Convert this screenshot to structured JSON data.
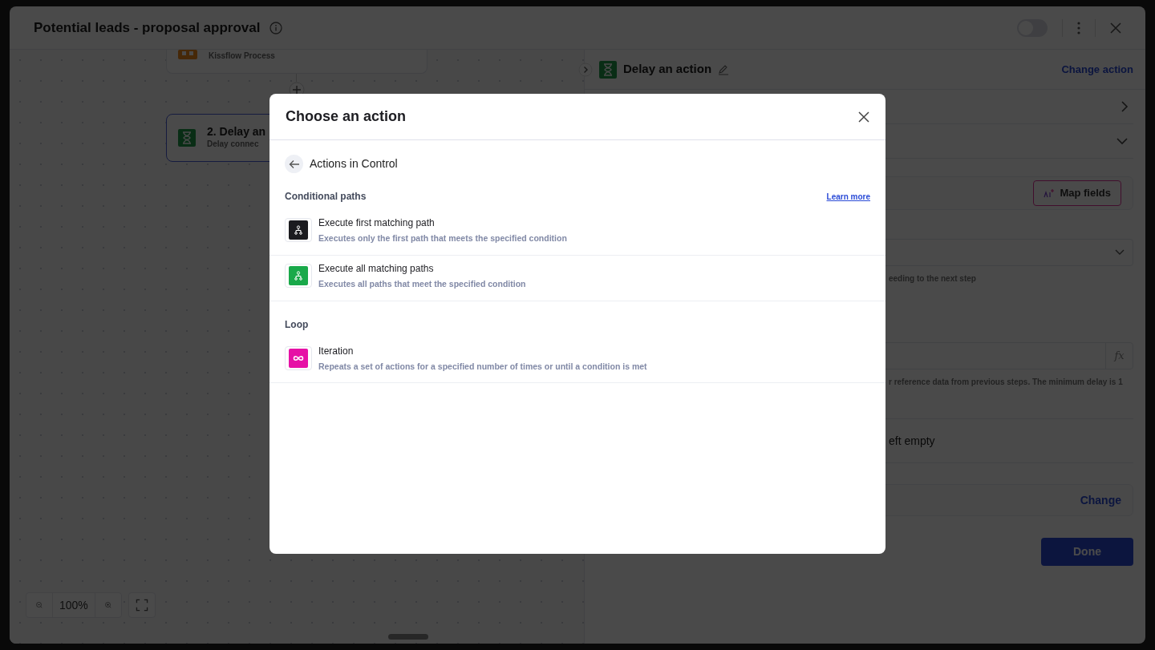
{
  "window": {
    "title": "Potential leads - proposal approval",
    "toggle": {
      "on": false
    }
  },
  "canvas": {
    "nodes": [
      {
        "kind": "process",
        "subtitle": "Kissflow Process",
        "selected": false
      },
      {
        "kind": "delay",
        "title": "2. Delay an",
        "subtitle": "Delay connec",
        "selected": true
      }
    ],
    "zoom": "100%"
  },
  "panel": {
    "title": "Delay an action",
    "change_action": "Change action",
    "map_fields": "Map fields",
    "select_hint": "eeding to the next step",
    "fx": "fx",
    "input_hint": "r reference data from previous steps. The minimum delay is 1",
    "option_text": "eft empty",
    "change": "Change",
    "done": "Done"
  },
  "modal": {
    "title": "Choose an action",
    "back_label": "Actions in Control",
    "sections": [
      {
        "title": "Conditional paths",
        "link": "Learn more",
        "actions": [
          {
            "kind": "branch",
            "color": "#1b1b1f",
            "title": "Execute first matching path",
            "description": "Executes only the first path that meets the specified condition"
          },
          {
            "kind": "branch",
            "color": "#19a94a",
            "title": "Execute all matching paths",
            "description": "Executes all paths that meet the specified condition"
          }
        ]
      },
      {
        "title": "Loop",
        "actions": [
          {
            "kind": "loop",
            "color": "#e611a6",
            "title": "Iteration",
            "description": "Repeats a set of actions for a specified number of times or until a condition is met"
          }
        ]
      }
    ]
  }
}
